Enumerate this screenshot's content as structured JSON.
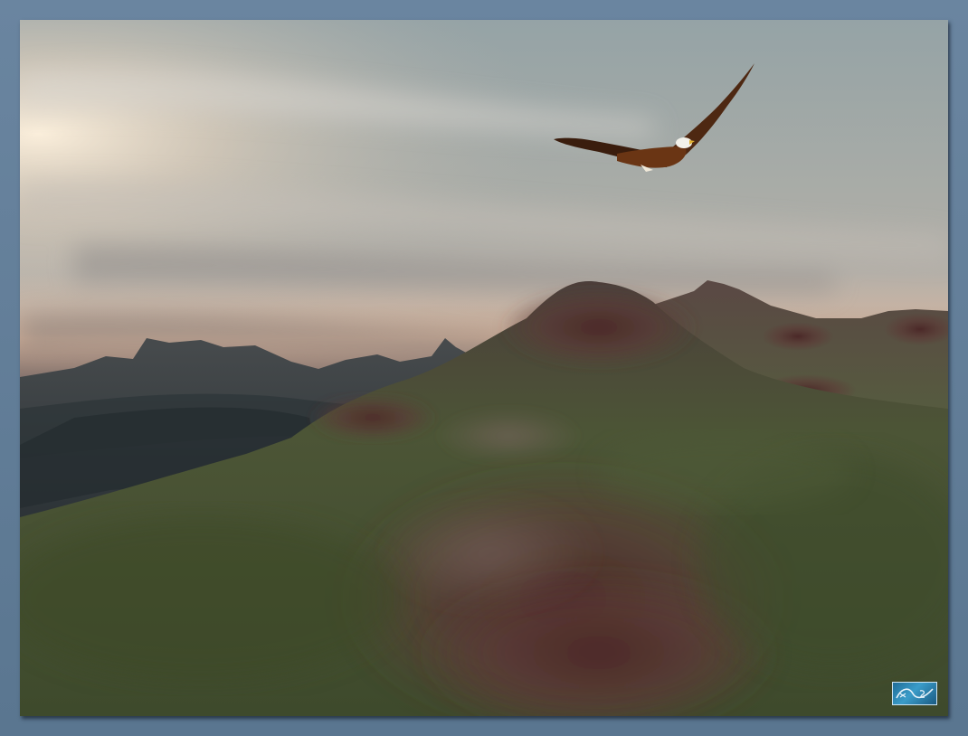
{
  "scene": {
    "sky_top": "#9aa7aa",
    "sky_mid": "#b9b3aa",
    "horizon_glow": "#f0d4b6",
    "far_mountain": "#3b4247",
    "hill_green": "#4a5a34",
    "hill_rust": "#5a3a35",
    "eagle_body": "#5a2c12",
    "eagle_head": "#f2f0ea"
  },
  "frame": {
    "border_color": "#5f7a94"
  },
  "signature": {
    "logo": "artist-signature-logo",
    "color": "#2f86b6"
  }
}
